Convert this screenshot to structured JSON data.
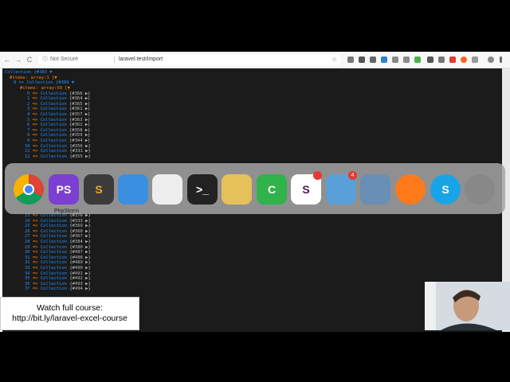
{
  "browser": {
    "nav": {
      "back": "←",
      "forward": "→",
      "reload": "C"
    },
    "security_label": "Not Secure",
    "url": "laravel.test/import"
  },
  "dump": {
    "header": "Collection {#383 ▼",
    "items_label": "#items: array:1 [▼",
    "first": "0 => Collection {#389 ▼",
    "inner_items": "#items: array:50 [▼",
    "rows_top": [
      {
        "n": "0",
        "id": "{#366 ▶}"
      },
      {
        "n": "1",
        "id": "{#364 ▶}"
      },
      {
        "n": "2",
        "id": "{#365 ▶}"
      },
      {
        "n": "3",
        "id": "{#361 ▶}"
      },
      {
        "n": "4",
        "id": "{#357 ▶}"
      },
      {
        "n": "5",
        "id": "{#363 ▶}"
      },
      {
        "n": "6",
        "id": "{#362 ▶}"
      },
      {
        "n": "7",
        "id": "{#358 ▶}"
      },
      {
        "n": "8",
        "id": "{#359 ▶}"
      },
      {
        "n": "9",
        "id": "{#344 ▶}"
      },
      {
        "n": "10",
        "id": "{#356 ▶}"
      },
      {
        "n": "11",
        "id": "{#331 ▶}"
      },
      {
        "n": "12",
        "id": "{#355 ▶}"
      }
    ],
    "rows_bottom": [
      {
        "n": "23",
        "id": "{#376 ▶}"
      },
      {
        "n": "24",
        "id": "{#333 ▶}"
      },
      {
        "n": "25",
        "id": "{#369 ▶}"
      },
      {
        "n": "26",
        "id": "{#360 ▶}"
      },
      {
        "n": "27",
        "id": "{#367 ▶}"
      },
      {
        "n": "28",
        "id": "{#384 ▶}"
      },
      {
        "n": "29",
        "id": "{#380 ▶}"
      },
      {
        "n": "30",
        "id": "{#487 ▶}"
      },
      {
        "n": "31",
        "id": "{#488 ▶}"
      },
      {
        "n": "32",
        "id": "{#489 ▶}"
      },
      {
        "n": "33",
        "id": "{#490 ▶}"
      },
      {
        "n": "34",
        "id": "{#491 ▶}"
      },
      {
        "n": "35",
        "id": "{#492 ▶}"
      },
      {
        "n": "36",
        "id": "{#493 ▶}"
      },
      {
        "n": "37",
        "id": "{#494 ▶}"
      }
    ],
    "arrow": "=>",
    "class_name": "Collection"
  },
  "dock": {
    "active_label": "PhpStorm",
    "apps": [
      {
        "name": "chrome-icon",
        "color": "#db4437"
      },
      {
        "name": "phpstorm-icon",
        "color": "#7b3fd1",
        "text": "PS"
      },
      {
        "name": "sublime-icon",
        "color": "#3b3b3b",
        "text": "S"
      },
      {
        "name": "finder-icon",
        "color": "#3a8fe0"
      },
      {
        "name": "numbers-icon",
        "color": "#eeeeee"
      },
      {
        "name": "terminal-icon",
        "color": "#222222",
        "text": ">_"
      },
      {
        "name": "sequel-pro-icon",
        "color": "#e6c15a"
      },
      {
        "name": "camtasia-icon",
        "color": "#2fb34a",
        "text": "C"
      },
      {
        "name": "slack-icon",
        "color": "#ffffff",
        "text": "S"
      },
      {
        "name": "mail-icon",
        "color": "#5aa0d8"
      },
      {
        "name": "preview-icon",
        "color": "#6a8fb7"
      },
      {
        "name": "firefox-icon",
        "color": "#ff7a1a"
      },
      {
        "name": "skype-icon",
        "color": "#1aa4e8",
        "text": "S"
      },
      {
        "name": "system-preferences-icon",
        "color": "#888888"
      }
    ],
    "badges": [
      {
        "app": "slack-icon",
        "count": ""
      },
      {
        "app": "mail-icon",
        "count": "4"
      }
    ]
  },
  "overlay": {
    "line1": "Watch full course:",
    "line2": "http://bit.ly/laravel-excel-course"
  }
}
